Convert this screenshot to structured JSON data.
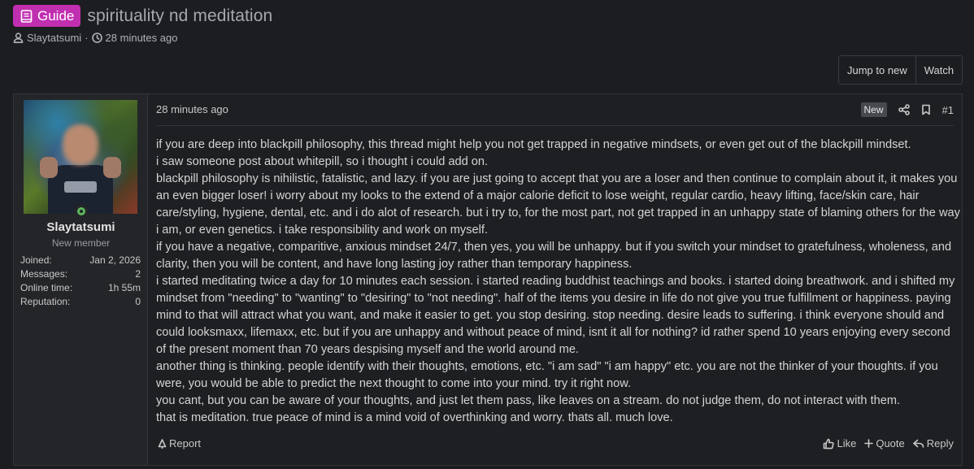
{
  "thread": {
    "prefix": "Guide",
    "title": "spirituality nd meditation",
    "author": "Slaytatsumi",
    "separator": "·",
    "time": "28 minutes ago"
  },
  "buttons": {
    "jump_to_new": "Jump to new",
    "watch": "Watch"
  },
  "user": {
    "name": "Slaytatsumi",
    "title": "New member",
    "stats": [
      {
        "label": "Joined:",
        "value": "Jan 2, 2026"
      },
      {
        "label": "Messages:",
        "value": "2"
      },
      {
        "label": "Online time:",
        "value": "1h 55m"
      },
      {
        "label": "Reputation:",
        "value": "0"
      }
    ]
  },
  "post": {
    "date": "28 minutes ago",
    "new_badge": "New",
    "number": "#1",
    "paragraphs": [
      "if you are deep into blackpill philosophy, this thread might help you not get trapped in negative mindsets, or even get out of the blackpill mindset.",
      "i saw someone post about whitepill, so i thought i could add on.",
      "blackpill philosophy is nihilistic, fatalistic, and lazy. if you are just going to accept that you are a loser and then continue to complain about it, it makes you an even bigger loser! i worry about my looks to the extend of a major calorie deficit to lose weight, regular cardio, heavy lifting, face/skin care, hair care/styling, hygiene, dental, etc. and i do alot of research. but i try to, for the most part, not get trapped in an unhappy state of blaming others for the way i am, or even genetics. i take responsibility and work on myself.",
      "if you have a negative, comparitive, anxious mindset 24/7, then yes, you will be unhappy. but if you switch your mindset to gratefulness, wholeness, and clarity, then you will be content, and have long lasting joy rather than temporary happiness.",
      "i started meditating twice a day for 10 minutes each session. i started reading buddhist teachings and books. i started doing breathwork. and i shifted my mindset from \"needing\" to \"wanting\" to \"desiring\" to \"not needing\". half of the items you desire in life do not give you true fulfillment or happiness. paying mind to that will attract what you want, and make it easier to get. you stop desiring. stop needing. desire leads to suffering. i think everyone should and could looksmaxx, lifemaxx, etc. but if you are unhappy and without peace of mind, isnt it all for nothing? id rather spend 10 years enjoying every second of the present moment than 70 years despising myself and the world around me.",
      "another thing is thinking. people identify with their thoughts, emotions, etc. \"i am sad\" \"i am happy\" etc. you are not the thinker of your thoughts. if you were, you would be able to predict the next thought to come into your mind. try it right now.",
      "you cant, but you can be aware of your thoughts, and just let them pass, like leaves on a stream. do not judge them, do not interact with them.",
      "that is meditation. true peace of mind is a mind void of overthinking and worry. thats all. much love."
    ],
    "report": "Report",
    "like": "Like",
    "quote": "Quote",
    "reply": "Reply"
  },
  "colors": {
    "prefix_badge": "#c12fb1",
    "online": "#5cb85c",
    "background": "#1c1d20"
  },
  "icons": [
    "book-icon",
    "user-icon",
    "clock-icon",
    "share-icon",
    "bookmark-icon",
    "flag-icon",
    "thumbs-up-icon",
    "plus-icon",
    "reply-icon"
  ]
}
